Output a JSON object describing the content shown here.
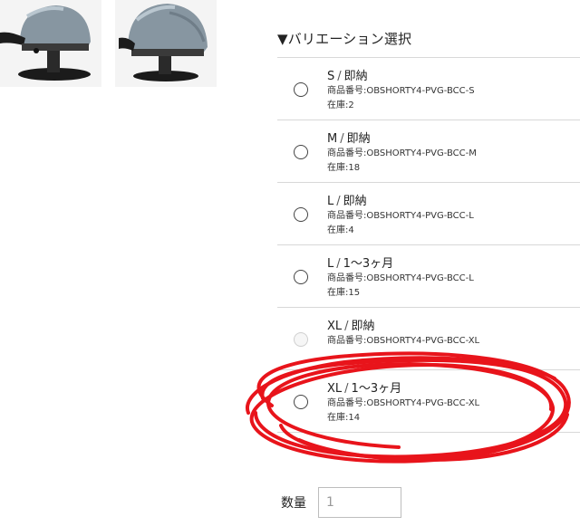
{
  "product_images": [
    {
      "name": "helmet-photo-front"
    },
    {
      "name": "helmet-photo-side"
    }
  ],
  "variation_section": {
    "title": "▼バリエーション選択",
    "items": [
      {
        "size": "S",
        "availability": "即納",
        "code": "商品番号:OBSHORTY4-PVG-BCC-S",
        "stock": "在庫:2",
        "disabled": false
      },
      {
        "size": "M",
        "availability": "即納",
        "code": "商品番号:OBSHORTY4-PVG-BCC-M",
        "stock": "在庫:18",
        "disabled": false
      },
      {
        "size": "L",
        "availability": "即納",
        "code": "商品番号:OBSHORTY4-PVG-BCC-L",
        "stock": "在庫:4",
        "disabled": false
      },
      {
        "size": "L",
        "availability": "1〜3ヶ月",
        "code": "商品番号:OBSHORTY4-PVG-BCC-L",
        "stock": "在庫:15",
        "disabled": false
      },
      {
        "size": "XL",
        "availability": "即納",
        "code": "商品番号:OBSHORTY4-PVG-BCC-XL",
        "stock": "",
        "disabled": true
      },
      {
        "size": "XL",
        "availability": "1〜3ヶ月",
        "code": "商品番号:OBSHORTY4-PVG-BCC-XL",
        "stock": "在庫:14",
        "disabled": false
      }
    ],
    "separator": "/"
  },
  "quantity": {
    "label": "数量",
    "value": "1"
  },
  "colors": {
    "annotation": "#e8141b",
    "helmet": "#8796a1",
    "divider": "#d8d8d8"
  }
}
